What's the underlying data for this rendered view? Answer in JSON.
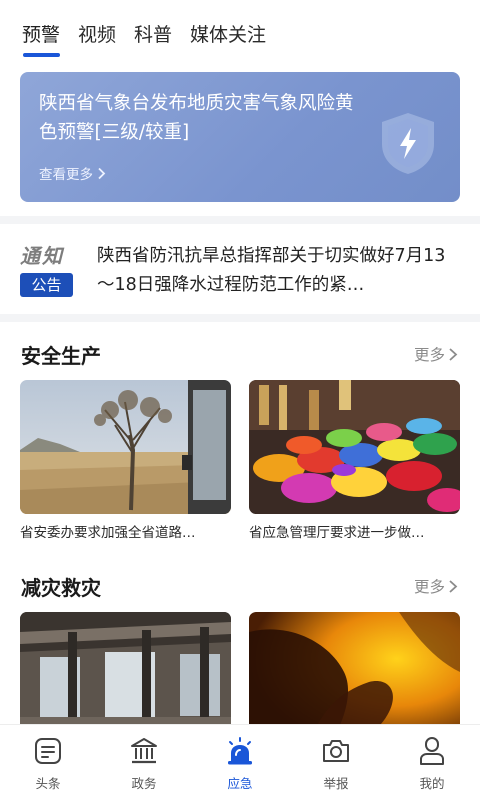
{
  "tabs": [
    {
      "label": "预警",
      "active": true
    },
    {
      "label": "视频",
      "active": false
    },
    {
      "label": "科普",
      "active": false
    },
    {
      "label": "媒体关注",
      "active": false
    }
  ],
  "banner": {
    "title": "陕西省气象台发布地质灾害气象风险黄色预警[三级/较重]",
    "more_label": "查看更多",
    "icon": "lightning-shield-icon"
  },
  "notice": {
    "word": "通知",
    "tag": "公告",
    "text": "陕西省防汛抗旱总指挥部关于切实做好7月13～18日强降水过程防范工作的紧…"
  },
  "sections": {
    "safety": {
      "title": "安全生产",
      "more_label": "更多",
      "cards": [
        {
          "caption": "省安委办要求加强全省道路…",
          "image": "savanna-tree-photo"
        },
        {
          "caption": "省应急管理厅要求进一步做…",
          "image": "colored-powder-market-photo"
        }
      ]
    },
    "disaster": {
      "title": "减灾救灾",
      "more_label": "更多",
      "cards": [
        {
          "caption": "",
          "image": "ruined-building-photo"
        },
        {
          "caption": "",
          "image": "face-in-orange-light-photo"
        }
      ]
    }
  },
  "bottom_nav": [
    {
      "label": "头条",
      "icon": "headline-icon",
      "active": false
    },
    {
      "label": "政务",
      "icon": "government-building-icon",
      "active": false
    },
    {
      "label": "应急",
      "icon": "alarm-siren-icon",
      "active": true
    },
    {
      "label": "举报",
      "icon": "camera-icon",
      "active": false
    },
    {
      "label": "我的",
      "icon": "user-icon",
      "active": false
    }
  ],
  "colors": {
    "accent": "#1a56d8",
    "banner": "#7f98d0",
    "notice_tag": "#1d4fb8"
  }
}
